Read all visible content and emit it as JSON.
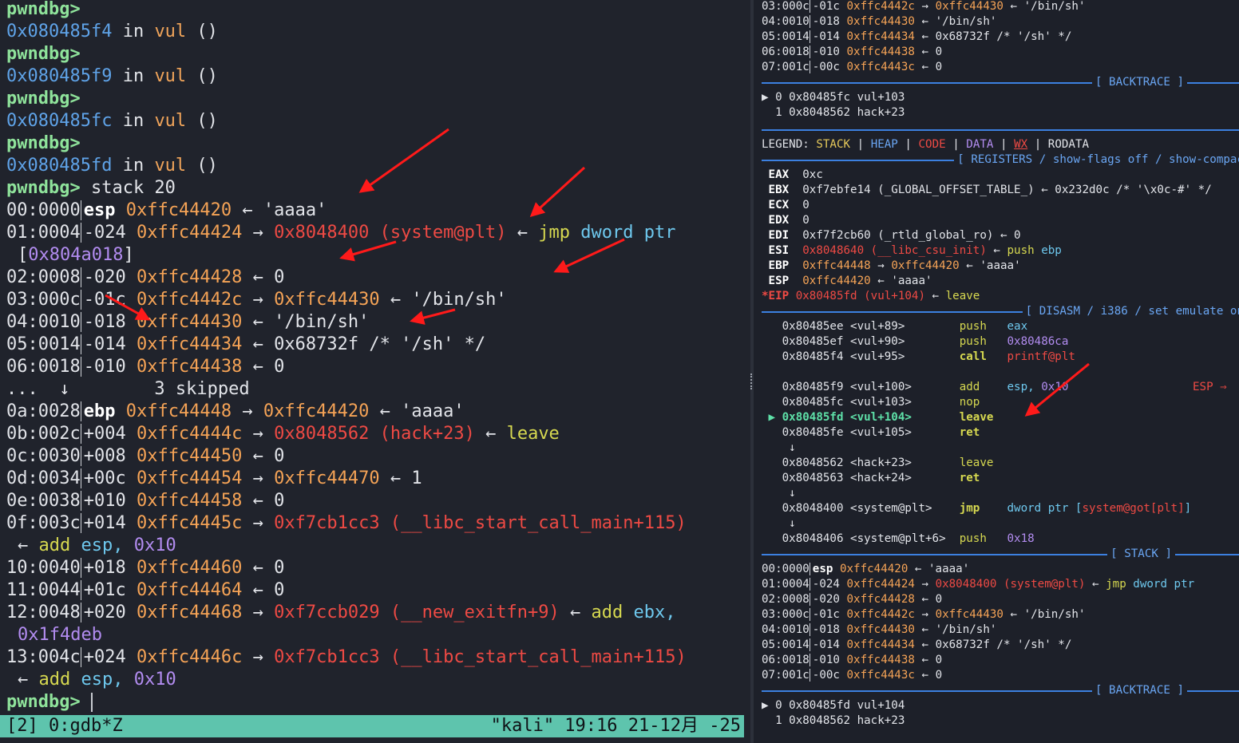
{
  "left": {
    "prompt": "pwndbg>",
    "trace_lines": [
      {
        "addr": "0x080485f4",
        "fn": "vul"
      },
      {
        "addr": "0x080485f9",
        "fn": "vul"
      },
      {
        "addr": "0x080485fc",
        "fn": "vul"
      },
      {
        "addr": "0x080485fd",
        "fn": "vul"
      }
    ],
    "in_word": "in",
    "parens": "()",
    "command": "stack 20",
    "stack": [
      {
        "idx": "00:0000",
        "off": "esp",
        "addr": "0xffc44420",
        "arrow": "←",
        "val": "'aaaa'"
      },
      {
        "idx": "01:0004",
        "off": "-024",
        "addr": "0xffc44424",
        "arrow": "→",
        "val": "0x8048400 (system@plt)",
        "extra": "← jmp dword ptr",
        "wrap": "[0x804a018]"
      },
      {
        "idx": "02:0008",
        "off": "-020",
        "addr": "0xffc44428",
        "arrow": "←",
        "val": "0"
      },
      {
        "idx": "03:000c",
        "off": "-01c",
        "addr": "0xffc4442c",
        "arrow": "→",
        "val": "0xffc44430",
        "extra": "← '/bin/sh'"
      },
      {
        "idx": "04:0010",
        "off": "-018",
        "addr": "0xffc44430",
        "arrow": "←",
        "val": "'/bin/sh'"
      },
      {
        "idx": "05:0014",
        "off": "-014",
        "addr": "0xffc44434",
        "arrow": "←",
        "val": "0x68732f /* '/sh' */"
      },
      {
        "idx": "06:0018",
        "off": "-010",
        "addr": "0xffc44438",
        "arrow": "←",
        "val": "0"
      },
      {
        "idx": "0a:0028",
        "off": "ebp",
        "addr": "0xffc44448",
        "arrow": "→",
        "val": "0xffc44420",
        "extra": "← 'aaaa'"
      },
      {
        "idx": "0b:002c",
        "off": "+004",
        "addr": "0xffc4444c",
        "arrow": "→",
        "val": "0x8048562 (hack+23)",
        "extra": "← leave"
      },
      {
        "idx": "0c:0030",
        "off": "+008",
        "addr": "0xffc44450",
        "arrow": "←",
        "val": "0"
      },
      {
        "idx": "0d:0034",
        "off": "+00c",
        "addr": "0xffc44454",
        "arrow": "→",
        "val": "0xffc44470",
        "extra": "← 1"
      },
      {
        "idx": "0e:0038",
        "off": "+010",
        "addr": "0xffc44458",
        "arrow": "←",
        "val": "0"
      },
      {
        "idx": "0f:003c",
        "off": "+014",
        "addr": "0xffc4445c",
        "arrow": "→",
        "val": "0xf7cb1cc3 (__libc_start_call_main+115)",
        "wrap": "← add esp, 0x10"
      },
      {
        "idx": "10:0040",
        "off": "+018",
        "addr": "0xffc44460",
        "arrow": "←",
        "val": "0"
      },
      {
        "idx": "11:0044",
        "off": "+01c",
        "addr": "0xffc44464",
        "arrow": "←",
        "val": "0"
      },
      {
        "idx": "12:0048",
        "off": "+020",
        "addr": "0xffc44468",
        "arrow": "→",
        "val": "0xf7ccb029 (__new_exitfn+9)",
        "extra": "← add ebx,",
        "wrap": "0x1f4deb"
      },
      {
        "idx": "13:004c",
        "off": "+024",
        "addr": "0xffc4446c",
        "arrow": "→",
        "val": "0xf7cb1cc3 (__libc_start_call_main+115)",
        "wrap": "← add esp, 0x10"
      }
    ],
    "skipped": "...  ↓        3 skipped",
    "status_left": "[2] 0:gdb*Z",
    "status_right": "\"kali\" 19:16 21-12月 -25"
  },
  "right": {
    "top_stack": [
      {
        "idx": "03:000c",
        "off": "-01c",
        "addr": "0xffc4442c",
        "arrow": "→",
        "val": "0xffc44430",
        "extra": "← '/bin/sh'"
      },
      {
        "idx": "04:0010",
        "off": "-018",
        "addr": "0xffc44430",
        "arrow": "←",
        "val": "'/bin/sh'"
      },
      {
        "idx": "05:0014",
        "off": "-014",
        "addr": "0xffc44434",
        "arrow": "←",
        "val": "0x68732f /* '/sh' */"
      },
      {
        "idx": "06:0018",
        "off": "-010",
        "addr": "0xffc44438",
        "arrow": "←",
        "val": "0"
      },
      {
        "idx": "07:001c",
        "off": "-00c",
        "addr": "0xffc4443c",
        "arrow": "←",
        "val": "0"
      }
    ],
    "backtrace_title": "[ BACKTRACE ]",
    "bt1": [
      "▶ 0 0x80485fc vul+103",
      "  1 0x8048562 hack+23"
    ],
    "legend": {
      "label": "LEGEND:",
      "stack": "STACK",
      "heap": "HEAP",
      "code": "CODE",
      "data": "DATA",
      "wx": "WX",
      "rodata": "RODATA",
      "bar": "|"
    },
    "registers_title": "[ REGISTERS / show-flags off / show-compac",
    "registers": [
      {
        "name": "EAX",
        "val": "0xc"
      },
      {
        "name": "EBX",
        "val": "0xf7ebfe14 (_GLOBAL_OFFSET_TABLE_) ← 0x232d0c /* '\\x0c-#' */"
      },
      {
        "name": "ECX",
        "val": "0"
      },
      {
        "name": "EDX",
        "val": "0"
      },
      {
        "name": "EDI",
        "val": "0xf7f2cb60 (_rtld_global_ro) ← 0"
      },
      {
        "name": "ESI",
        "val": "0x8048640 (__libc_csu_init)",
        "extra": "← push ebp"
      },
      {
        "name": "EBP",
        "val": "0xffc44448",
        "extra": "→ 0xffc44420 ← 'aaaa'"
      },
      {
        "name": "ESP",
        "val": "0xffc44420",
        "extra": "← 'aaaa'"
      },
      {
        "name": "*EIP",
        "val": "0x80485fd (vul+104)",
        "extra": "← leave"
      }
    ],
    "disasm_title": "[ DISASM / i386 / set emulate on",
    "disasm": [
      {
        "addr": "0x80485ee",
        "sym": "<vul+89>",
        "op": "push",
        "arg": "eax"
      },
      {
        "addr": "0x80485ef",
        "sym": "<vul+90>",
        "op": "push",
        "arg": "0x80486ca"
      },
      {
        "addr": "0x80485f4",
        "sym": "<vul+95>",
        "op": "call",
        "arg": "printf@plt"
      },
      {
        "addr": "0x80485f9",
        "sym": "<vul+100>",
        "op": "add",
        "arg": "esp, 0x10",
        "note": "ESP ⇒"
      },
      {
        "addr": "0x80485fc",
        "sym": "<vul+103>",
        "op": "nop",
        "arg": ""
      },
      {
        "addr": "0x80485fd",
        "sym": "<vul+104>",
        "op": "leave",
        "arg": ""
      },
      {
        "addr": "0x80485fe",
        "sym": "<vul+105>",
        "op": "ret",
        "arg": ""
      },
      {
        "addr": "0x8048562",
        "sym": "<hack+23>",
        "op": "leave",
        "arg": ""
      },
      {
        "addr": "0x8048563",
        "sym": "<hack+24>",
        "op": "ret",
        "arg": ""
      },
      {
        "addr": "0x8048400",
        "sym": "<system@plt>",
        "op": "jmp",
        "arg": "dword ptr [system@got[plt]]"
      },
      {
        "addr": "0x8048406",
        "sym": "<system@plt+6>",
        "op": "push",
        "arg": "0x18"
      }
    ],
    "current_marker": "▶",
    "down_arrow": "↓",
    "stack_title": "[ STACK ]",
    "stack": [
      {
        "idx": "00:0000",
        "off": "esp",
        "addr": "0xffc44420",
        "arrow": "←",
        "val": "'aaaa'"
      },
      {
        "idx": "01:0004",
        "off": "-024",
        "addr": "0xffc44424",
        "arrow": "→",
        "val": "0x8048400 (system@plt)",
        "extra": "← jmp dword ptr"
      },
      {
        "idx": "02:0008",
        "off": "-020",
        "addr": "0xffc44428",
        "arrow": "←",
        "val": "0"
      },
      {
        "idx": "03:000c",
        "off": "-01c",
        "addr": "0xffc4442c",
        "arrow": "→",
        "val": "0xffc44430",
        "extra": "← '/bin/sh'"
      },
      {
        "idx": "04:0010",
        "off": "-018",
        "addr": "0xffc44430",
        "arrow": "←",
        "val": "'/bin/sh'"
      },
      {
        "idx": "05:0014",
        "off": "-014",
        "addr": "0xffc44434",
        "arrow": "←",
        "val": "0x68732f /* '/sh' */"
      },
      {
        "idx": "06:0018",
        "off": "-010",
        "addr": "0xffc44438",
        "arrow": "←",
        "val": "0"
      },
      {
        "idx": "07:001c",
        "off": "-00c",
        "addr": "0xffc4443c",
        "arrow": "←",
        "val": "0"
      }
    ],
    "bt2": [
      "▶ 0 0x80485fd vul+104",
      "  1 0x8048562 hack+23"
    ]
  },
  "colors": {
    "prompt": "#8fe39b",
    "address": "#5fa3e8",
    "stack": "#f5a356",
    "code": "#ee4a44",
    "annotation_arrow": "#ff1a1a",
    "statusbar": "#5ec4ad"
  }
}
